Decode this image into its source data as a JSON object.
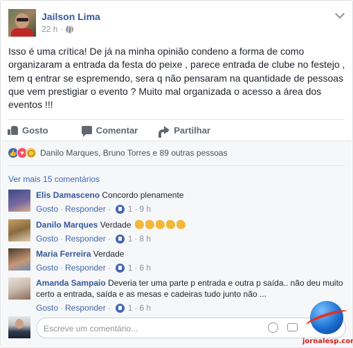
{
  "post": {
    "author": "Jailson Lima",
    "time": "22 h",
    "separator": "·",
    "text": "Isso é uma crítica! De já na minha opinião condeno a forma de como organizaram a entrada da festa do peixe , parece entrada de clube no festejo , tem q entrar se espremendo, sera q não pensaram na quantidade de pessoas que vem prestigiar o evento ? Muito mal organizada o acesso a área dos eventos !!!"
  },
  "actions": {
    "like": "Gosto",
    "comment": "Comentar",
    "share": "Partilhar"
  },
  "reactions": {
    "text": "Danilo Marques, Bruno Torres e 89 outras pessoas",
    "icons": [
      "like-reaction",
      "love-reaction",
      "wow-reaction"
    ]
  },
  "more_comments": "Ver mais 15 comentários",
  "comment_ui": {
    "like": "Gosto",
    "reply": "Responder",
    "sep": "·"
  },
  "comments": [
    {
      "name": "Elis Damasceno",
      "text": "Concordo plenamente",
      "likes": "1",
      "time": "9 h"
    },
    {
      "name": "Danilo Marques",
      "text": "Verdade",
      "likes": "1",
      "time": "8 h"
    },
    {
      "name": "Maria Ferreira",
      "text": "Verdade",
      "likes": "1",
      "time": "6 h"
    },
    {
      "name": "Amanda Sampaio",
      "text": "Deveria ter uma parte p entrada e outra p saída.. não deu muito certo a entrada, saída e as mesas e cadeiras tudo junto não ...",
      "likes": "1",
      "time": "6 h"
    }
  ],
  "write_comment": {
    "placeholder": "Escreve um comentário..."
  },
  "watermark": {
    "text": "jornalesp.com"
  }
}
